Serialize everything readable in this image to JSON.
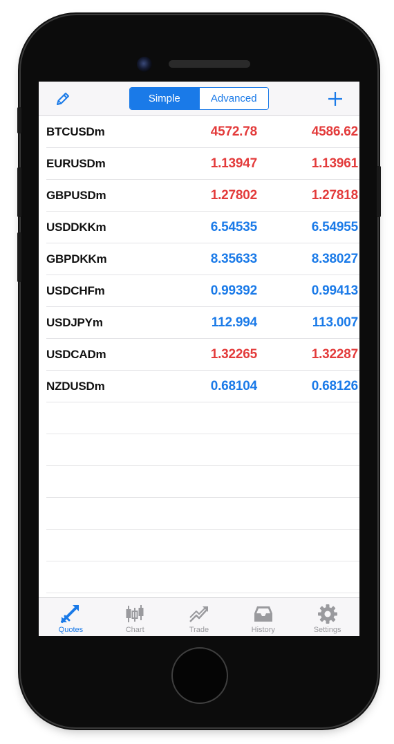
{
  "navbar": {
    "segments": {
      "simple": "Simple",
      "advanced": "Advanced"
    },
    "edit_icon": "pencil-icon",
    "add_icon": "plus-icon"
  },
  "colors": {
    "accent": "#1a7ae8",
    "down": "#e33b3b",
    "up": "#1a7ae8"
  },
  "quotes": [
    {
      "symbol": "BTCUSDm",
      "bid": "4572.78",
      "ask": "4586.62",
      "direction": "down"
    },
    {
      "symbol": "EURUSDm",
      "bid": "1.13947",
      "ask": "1.13961",
      "direction": "down"
    },
    {
      "symbol": "GBPUSDm",
      "bid": "1.27802",
      "ask": "1.27818",
      "direction": "down"
    },
    {
      "symbol": "USDDKKm",
      "bid": "6.54535",
      "ask": "6.54955",
      "direction": "up"
    },
    {
      "symbol": "GBPDKKm",
      "bid": "8.35633",
      "ask": "8.38027",
      "direction": "up"
    },
    {
      "symbol": "USDCHFm",
      "bid": "0.99392",
      "ask": "0.99413",
      "direction": "up"
    },
    {
      "symbol": "USDJPYm",
      "bid": "112.994",
      "ask": "113.007",
      "direction": "up"
    },
    {
      "symbol": "USDCADm",
      "bid": "1.32265",
      "ask": "1.32287",
      "direction": "down"
    },
    {
      "symbol": "NZDUSDm",
      "bid": "0.68104",
      "ask": "0.68126",
      "direction": "up"
    }
  ],
  "tabbar": {
    "quotes": "Quotes",
    "chart": "Chart",
    "trade": "Trade",
    "history": "History",
    "settings": "Settings"
  }
}
